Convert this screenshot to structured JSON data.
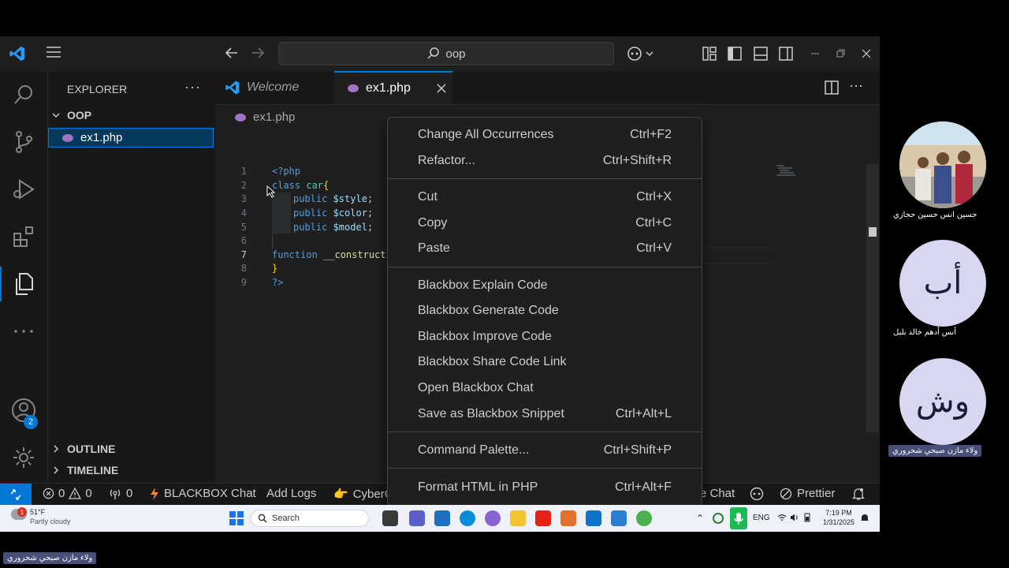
{
  "titlebar": {
    "search_text": "oop"
  },
  "sidebar": {
    "title": "EXPLORER",
    "folder": "OOP",
    "file": "ex1.php",
    "outline": "OUTLINE",
    "timeline": "TIMELINE",
    "accounts_badge": "2"
  },
  "tabs": [
    {
      "label": "Welcome"
    },
    {
      "label": "ex1.php"
    }
  ],
  "breadcrumb": "ex1.php",
  "code_lines": [
    "1",
    "2",
    "3",
    "4",
    "5",
    "6",
    "7",
    "8",
    "9"
  ],
  "code": {
    "l1": "<?php",
    "l2a": "class ",
    "l2b": "car",
    "l2c": "{",
    "l3a": "public ",
    "l3b": "$style",
    "l3c": ";",
    "l4a": "public ",
    "l4b": "$color",
    "l4c": ";",
    "l5a": "public ",
    "l5b": "$model",
    "l5c": ";",
    "l7a": "function ",
    "l7b": "__construct",
    "l7c": "(",
    "l8": "}",
    "l9": "?>"
  },
  "context_menu": {
    "items": [
      {
        "label": "Change All Occurrences",
        "shortcut": "Ctrl+F2"
      },
      {
        "label": "Refactor...",
        "shortcut": "Ctrl+Shift+R"
      },
      {
        "label": "Cut",
        "shortcut": "Ctrl+X"
      },
      {
        "label": "Copy",
        "shortcut": "Ctrl+C"
      },
      {
        "label": "Paste",
        "shortcut": "Ctrl+V"
      },
      {
        "label": "Blackbox Explain Code",
        "shortcut": ""
      },
      {
        "label": "Blackbox Generate Code",
        "shortcut": ""
      },
      {
        "label": "Blackbox Improve Code",
        "shortcut": ""
      },
      {
        "label": "Blackbox Share Code Link",
        "shortcut": ""
      },
      {
        "label": "Open Blackbox Chat",
        "shortcut": ""
      },
      {
        "label": "Save as Blackbox Snippet",
        "shortcut": "Ctrl+Alt+L"
      },
      {
        "label": "Command Palette...",
        "shortcut": "Ctrl+Shift+P"
      },
      {
        "label": "Format HTML in PHP",
        "shortcut": "Ctrl+Alt+F"
      }
    ]
  },
  "statusbar": {
    "errors": "0",
    "warnings": "0",
    "ports": "0",
    "blackbox_chat": "BLACKBOX Chat",
    "add_logs": "Add Logs",
    "cyber": "CyberC",
    "chat_tail": "e Chat",
    "prettier": "Prettier"
  },
  "taskbar": {
    "weather_temp": "51°F",
    "weather_desc": "Partly cloudy",
    "weather_badge": "1",
    "search_label": "Search",
    "lang": "ENG",
    "time": "7:19 PM",
    "date": "1/31/2025"
  },
  "participants": [
    {
      "name": "حسين انس حسين حجازي",
      "initials": ""
    },
    {
      "name": "أنس أدهم خالد بلبل",
      "initials": "أب"
    },
    {
      "name": "ولاء مازن صبحي شحروري",
      "initials": "وش"
    }
  ],
  "presenter_label": "ولاء مازن صبحي شحروري",
  "colors": {
    "accent": "#0078d4",
    "avatar_bg": "#d9d6f2",
    "avatar_text": "#1d1a3b"
  }
}
